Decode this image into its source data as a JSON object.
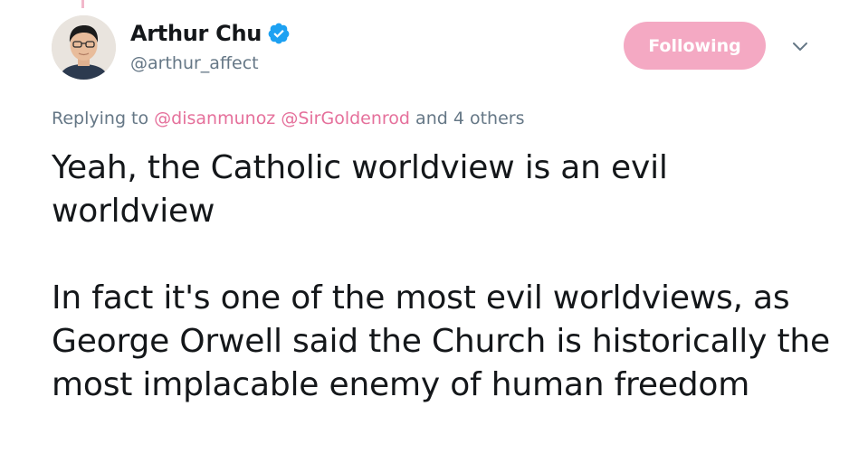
{
  "author": {
    "display_name": "Arthur Chu",
    "handle": "@arthur_affect",
    "verified": true,
    "avatar_icon": "user-avatar"
  },
  "follow_button": {
    "label": "Following",
    "color": "#f4a9c3"
  },
  "menu_icon": "chevron-down-icon",
  "reply": {
    "prefix": "Replying to",
    "mentions": [
      "@disanmunoz",
      "@SirGoldenrod"
    ],
    "suffix": "and 4 others",
    "mention_color": "#e5709b"
  },
  "tweet": {
    "paragraph_1": "Yeah, the Catholic worldview is an evil worldview",
    "paragraph_2": "In fact it's one of the most evil worldviews, as George Orwell said the Church is historically the most implacable enemy of human freedom"
  },
  "colors": {
    "verified_blue": "#1da1f2",
    "secondary_text": "#657786",
    "primary_text": "#14171a"
  }
}
